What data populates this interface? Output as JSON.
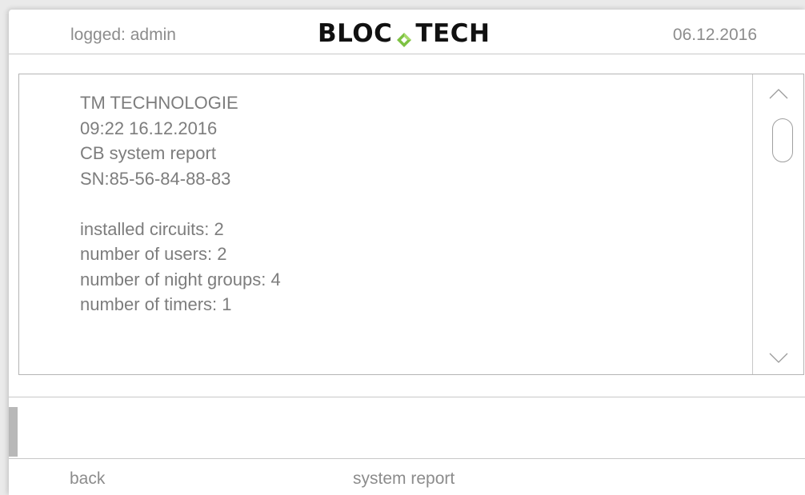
{
  "header": {
    "logged_text": "logged: admin",
    "logo_left": "BLOC",
    "logo_right": "TECH",
    "date": "06.12.2016"
  },
  "report": {
    "lines": [
      "TM TECHNOLOGIE",
      "09:22 16.12.2016",
      "CB system report",
      "SN:85-56-84-88-83",
      "",
      "installed circuits: 2",
      "number of users: 2",
      "number of night groups: 4",
      "number of timers: 1"
    ]
  },
  "scrollbar": {
    "up_icon": "chevron-up-icon",
    "down_icon": "chevron-down-icon"
  },
  "footer": {
    "back_label": "back",
    "title": "system report"
  },
  "colors": {
    "text_gray": "#8c8c8c",
    "logo_dark": "#111111",
    "logo_green": "#5cb85c",
    "border": "#b5b5b5"
  }
}
